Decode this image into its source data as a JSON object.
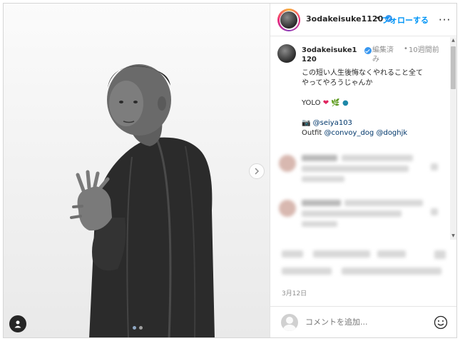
{
  "post": {
    "username": "3odakeisuke1120",
    "follow_separator": "•",
    "follow_label": "フォローする",
    "more_label": "···"
  },
  "caption": {
    "username": "3odakeisuke1120",
    "edited_label": "編集済み",
    "dot": "•",
    "time": "10週間前",
    "line1": "この短い人生後悔なくやれること全て",
    "line2": "やってやろうじゃんか",
    "yolo": "YOLO",
    "camera_emoji": "📷",
    "credit_mention": "@seiya103",
    "outfit_label": "Outfit",
    "outfit_mention_1": "@convoy_dog",
    "outfit_mention_2": "@doghjk"
  },
  "date": "3月12日",
  "comment_box": {
    "placeholder": "コメントを追加..."
  },
  "carousel": {
    "current": 1,
    "total": 2
  },
  "icons": {
    "next": "chevron-right-icon",
    "tag": "user-tag-icon",
    "emoji": "emoji-smile-icon",
    "verified": "verified-badge-icon"
  },
  "colors": {
    "follow": "#0095f6",
    "verified": "#3897f0",
    "mention": "#00376b"
  }
}
